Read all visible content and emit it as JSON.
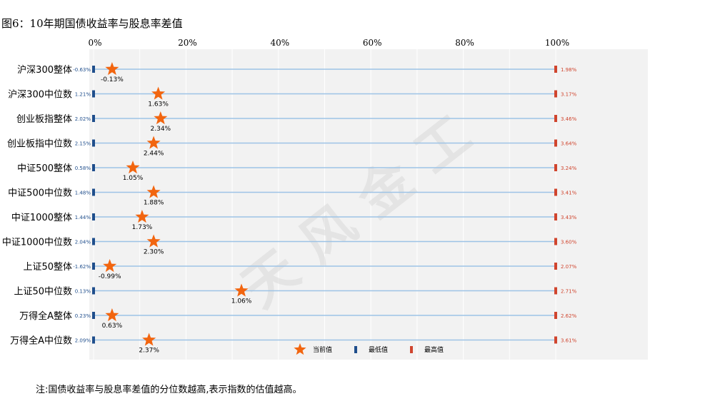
{
  "title": "图6：10年期国债收益率与股息率差值",
  "note": "注:国债收益率与股息率差值的分位数越高,表示指数的估值越高。",
  "watermark": "天风金工",
  "colors": {
    "current": "#f2650f",
    "min": "#1f4e8c",
    "max": "#d0452e",
    "line": "#9dc3e6",
    "plot_bg": "#f2f2f2",
    "grid": "#ffffff"
  },
  "chart_data": {
    "type": "dot-range",
    "x_ticks": [
      "0%",
      "20%",
      "40%",
      "60%",
      "80%",
      "100%"
    ],
    "xlim": [
      0,
      100
    ],
    "grid": true,
    "legend": {
      "placement": "bottom-center",
      "items": [
        {
          "label": "当前值",
          "icon": "star-icon"
        },
        {
          "label": "最低值",
          "icon": "bar-icon"
        },
        {
          "label": "最高值",
          "icon": "bar-icon"
        }
      ]
    },
    "categories": [
      "沪深300整体",
      "沪深300中位数",
      "创业板指整体",
      "创业板指中位数",
      "中证500整体",
      "中证500中位数",
      "中证1000整体",
      "中证1000中位数",
      "上证50整体",
      "上证50中位数",
      "万得全A整体",
      "万得全A中位数"
    ],
    "series": [
      {
        "name": "当前值",
        "percentile": [
          4,
          14,
          14.5,
          13,
          8.5,
          13,
          10.5,
          13,
          3.5,
          32,
          4,
          12
        ],
        "labels": [
          "-0.13%",
          "1.63%",
          "2.34%",
          "2.44%",
          "1.05%",
          "1.88%",
          "1.73%",
          "2.30%",
          "-0.99%",
          "1.06%",
          "0.63%",
          "2.37%"
        ]
      },
      {
        "name": "最低值",
        "percentile": [
          0,
          0,
          0,
          0,
          0,
          0,
          0,
          0,
          0,
          0,
          0,
          0
        ],
        "labels": [
          "-0.63%",
          "1.21%",
          "2.02%",
          "2.15%",
          "0.58%",
          "1.48%",
          "1.44%",
          "2.04%",
          "-1.62%",
          "0.13%",
          "0.23%",
          "2.09%"
        ]
      },
      {
        "name": "最高值",
        "percentile": [
          100,
          100,
          100,
          100,
          100,
          100,
          100,
          100,
          100,
          100,
          100,
          100
        ],
        "labels": [
          "1.98%",
          "3.17%",
          "3.46%",
          "3.64%",
          "3.24%",
          "3.41%",
          "3.43%",
          "3.60%",
          "2.07%",
          "2.71%",
          "2.62%",
          "3.61%"
        ]
      }
    ]
  }
}
